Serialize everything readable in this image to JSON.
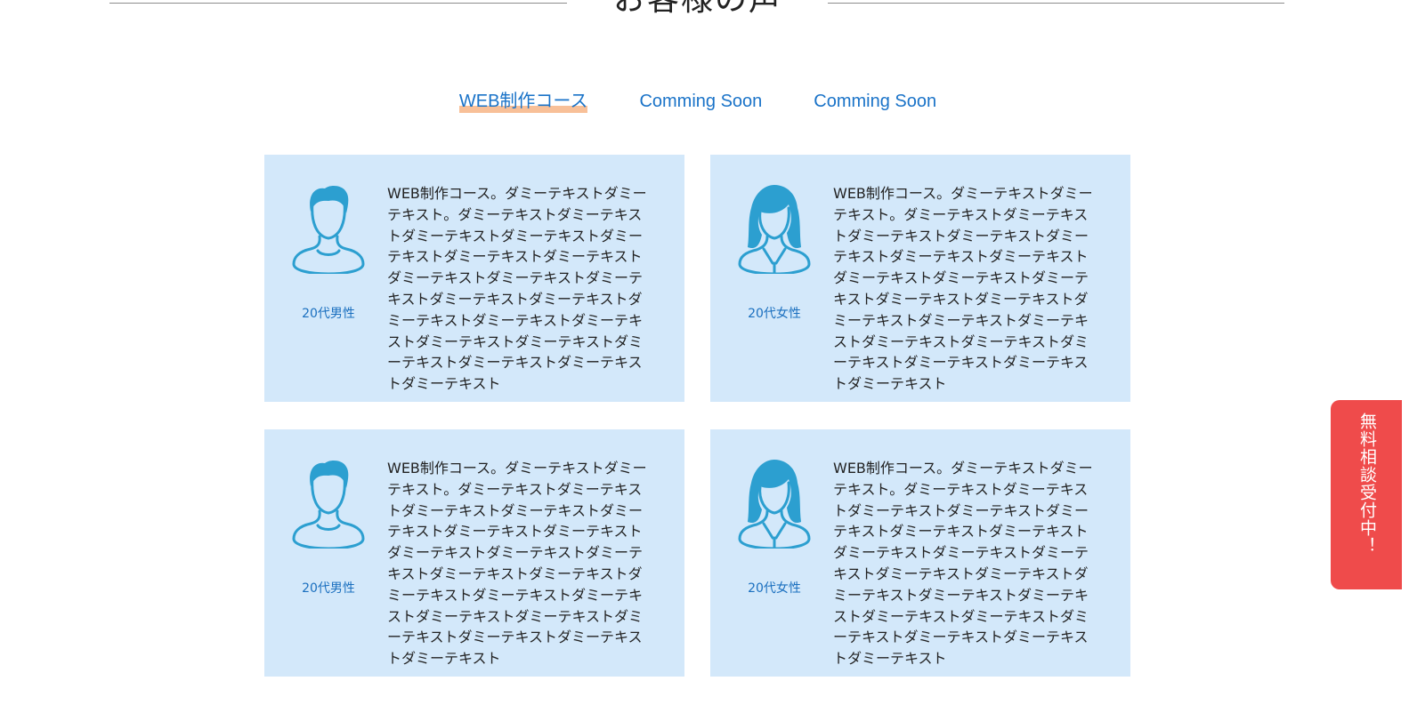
{
  "section": {
    "title": "お客様の声"
  },
  "tabs": [
    {
      "label": "WEB制作コース",
      "active": true
    },
    {
      "label": "Comming Soon",
      "active": false
    },
    {
      "label": "Comming Soon",
      "active": false
    }
  ],
  "cards": [
    {
      "avatar": "male-avatar-icon",
      "label": "20代男性",
      "text": "WEB制作コース。ダミーテキストダミーテキスト。ダミーテキストダミーテキストダミーテキストダミーテキストダミーテキストダミーテキストダミーテキストダミーテキストダミーテキストダミーテキストダミーテキストダミーテキストダミーテキストダミーテキストダミーテキストダミーテキストダミーテキストダミーテキストダミーテキストダミーテキストダミーテキスト"
    },
    {
      "avatar": "female-avatar-icon",
      "label": "20代女性",
      "text": "WEB制作コース。ダミーテキストダミーテキスト。ダミーテキストダミーテキストダミーテキストダミーテキストダミーテキストダミーテキストダミーテキストダミーテキストダミーテキストダミーテキストダミーテキストダミーテキストダミーテキストダミーテキストダミーテキストダミーテキストダミーテキストダミーテキストダミーテキストダミーテキストダミーテキスト"
    },
    {
      "avatar": "male-avatar-icon",
      "label": "20代男性",
      "text": "WEB制作コース。ダミーテキストダミーテキスト。ダミーテキストダミーテキストダミーテキストダミーテキストダミーテキストダミーテキストダミーテキストダミーテキストダミーテキストダミーテキストダミーテキストダミーテキストダミーテキストダミーテキストダミーテキストダミーテキストダミーテキストダミーテキストダミーテキストダミーテキストダミーテキスト"
    },
    {
      "avatar": "female-avatar-icon",
      "label": "20代女性",
      "text": "WEB制作コース。ダミーテキストダミーテキスト。ダミーテキストダミーテキストダミーテキストダミーテキストダミーテキストダミーテキストダミーテキストダミーテキストダミーテキストダミーテキストダミーテキストダミーテキストダミーテキストダミーテキストダミーテキストダミーテキストダミーテキストダミーテキストダミーテキストダミーテキストダミーテキスト"
    }
  ],
  "cta": {
    "label": "無料相談受付中！"
  },
  "colors": {
    "accent": "#1a73c8",
    "card_bg": "#d3e8fa",
    "icon": "#2c9fd0",
    "cta": "#ef4b4b",
    "tab_underline": "#f7b98d"
  }
}
